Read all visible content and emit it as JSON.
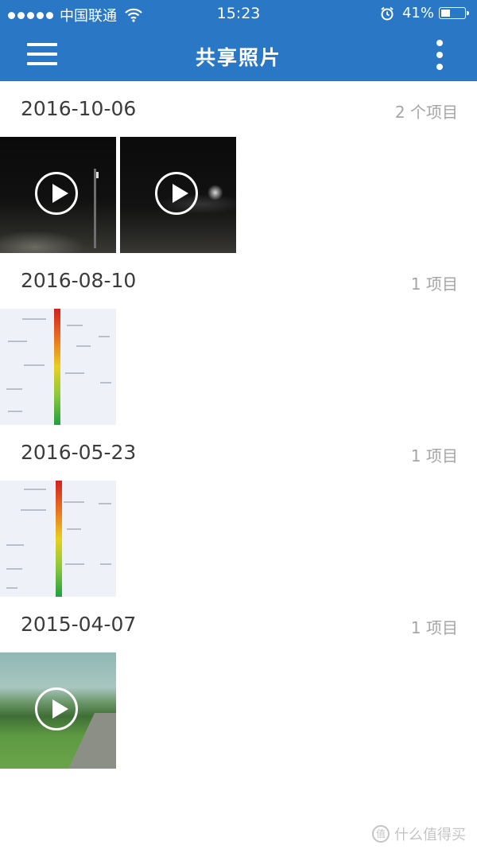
{
  "status_bar": {
    "carrier": "中国联通",
    "time": "15:23",
    "battery_percent": "41%",
    "battery_level": 0.41,
    "icons": [
      "signal-dots-icon",
      "wifi-icon",
      "alarm-icon",
      "battery-icon"
    ]
  },
  "app_bar": {
    "title": "共享照片",
    "left_icon": "menu-icon",
    "right_icon": "more-vertical-icon",
    "color": "#2a77c5"
  },
  "sections": [
    {
      "date": "2016-10-06",
      "count": "2 个项目",
      "items": [
        {
          "type": "video"
        },
        {
          "type": "video"
        }
      ]
    },
    {
      "date": "2016-08-10",
      "count": "1 项目",
      "items": [
        {
          "type": "image"
        }
      ]
    },
    {
      "date": "2016-05-23",
      "count": "1 项目",
      "items": [
        {
          "type": "image"
        }
      ]
    },
    {
      "date": "2015-04-07",
      "count": "1 项目",
      "items": [
        {
          "type": "video"
        }
      ]
    }
  ],
  "watermark": {
    "text": "什么值得买",
    "icon": "watermark-logo-icon"
  }
}
